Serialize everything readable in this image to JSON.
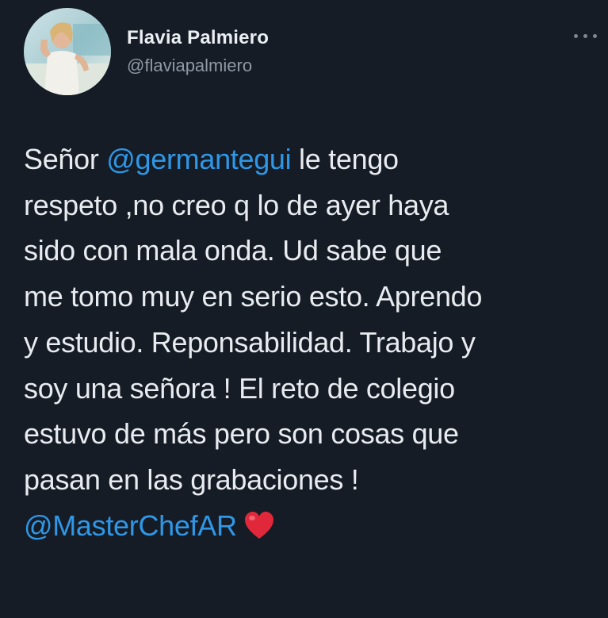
{
  "tweet": {
    "author": {
      "display_name": "Flavia Palmiero",
      "handle": "@flaviapalmiero"
    },
    "more_icon": "more-horizontal-icon",
    "text_lines": [
      [
        {
          "text": "Señor "
        },
        {
          "text": "@germantegui",
          "mention": true
        },
        {
          "text": " le tengo"
        }
      ],
      [
        {
          "text": "respeto ,no creo q lo de ayer haya"
        }
      ],
      [
        {
          "text": "sido con mala onda. Ud sabe que"
        }
      ],
      [
        {
          "text": "me tomo muy en serio esto. Aprendo"
        }
      ],
      [
        {
          "text": "y estudio. Reponsabilidad. Trabajo y"
        }
      ],
      [
        {
          "text": "soy una señora ! El reto de colegio"
        }
      ],
      [
        {
          "text": "estuvo de más pero son cosas que"
        }
      ],
      [
        {
          "text": "pasan en las grabaciones !"
        }
      ],
      [
        {
          "text": "@MasterChefAR",
          "mention": true
        }
      ]
    ],
    "emoji": "red-heart-icon",
    "colors": {
      "background": "#151c26",
      "mention": "#2f97e6",
      "text": "#e8ebef",
      "handle": "#8f99a4",
      "heart": "#e0283a"
    }
  }
}
